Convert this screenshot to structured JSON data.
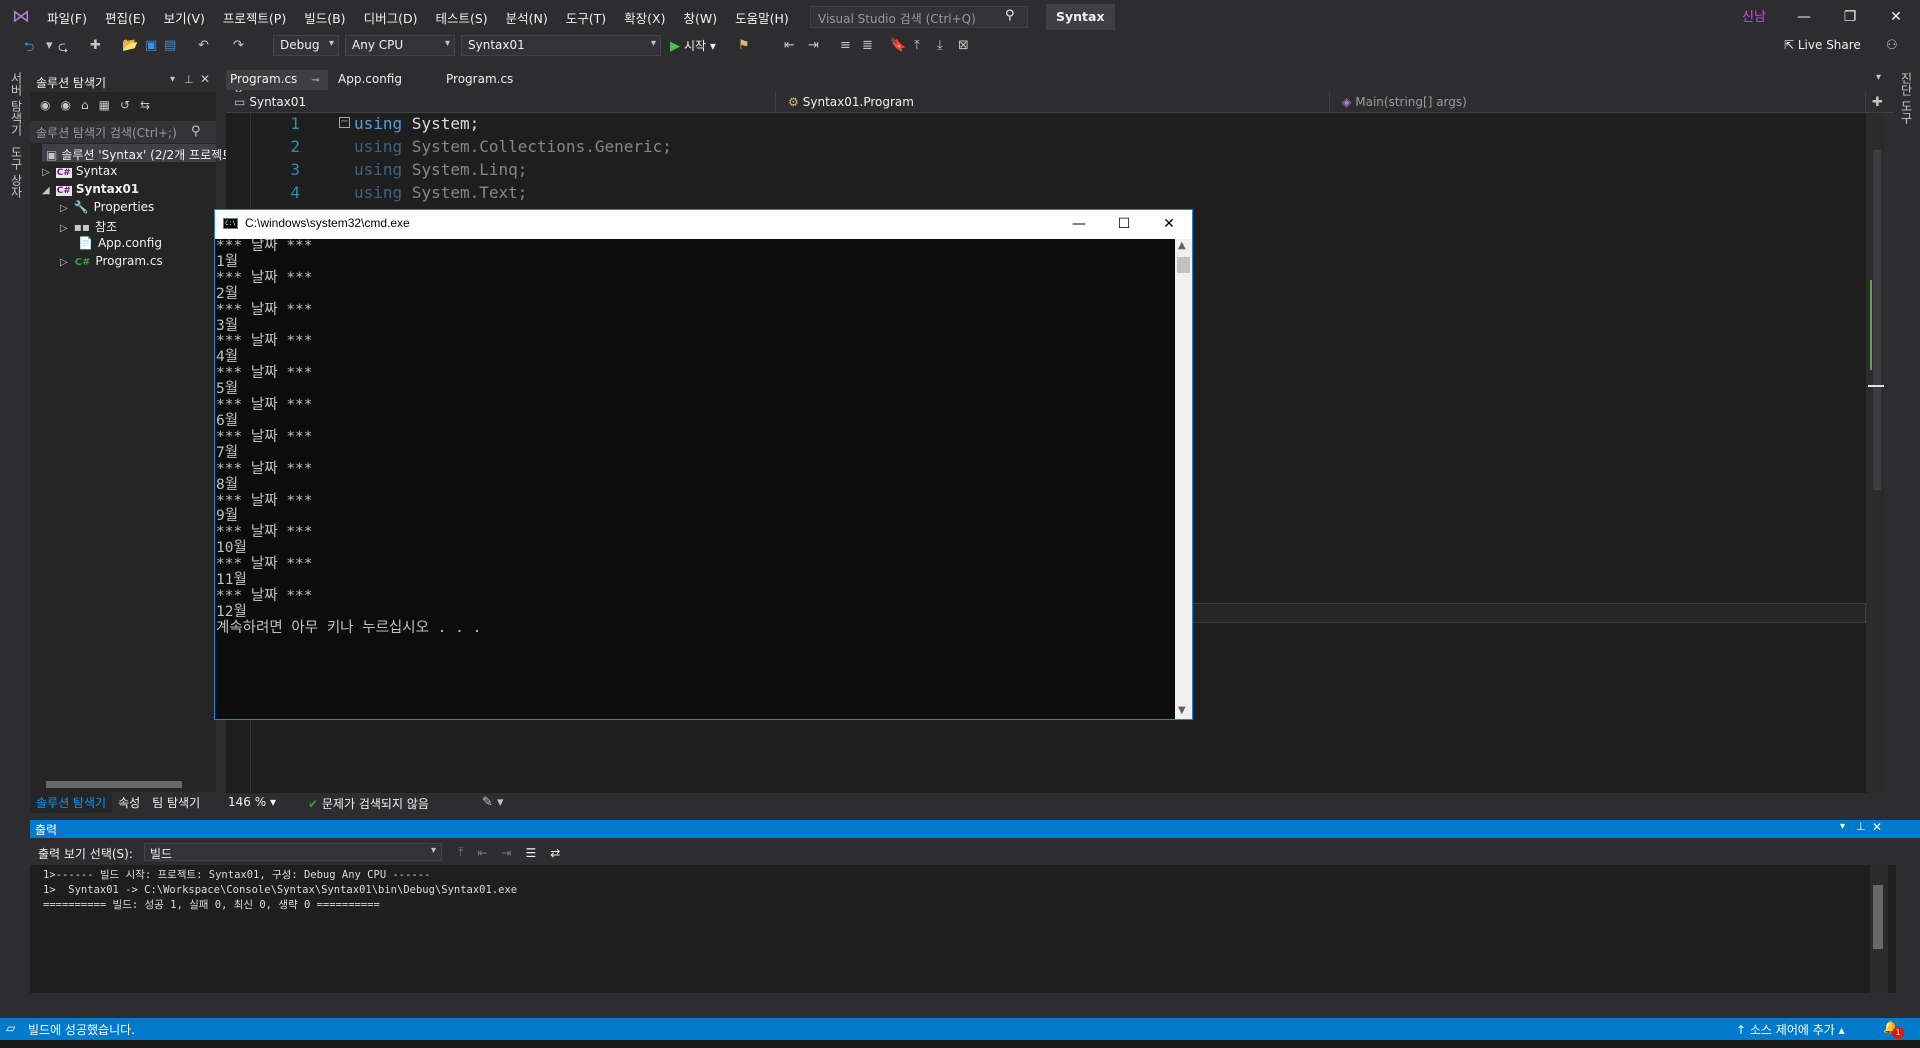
{
  "app": {
    "menu": [
      "파일(F)",
      "편집(E)",
      "보기(V)",
      "프로젝트(P)",
      "빌드(B)",
      "디버그(D)",
      "테스트(S)",
      "분석(N)",
      "도구(T)",
      "확장(X)",
      "창(W)",
      "도움말(H)"
    ],
    "search_placeholder": "Visual Studio 검색 (Ctrl+Q)",
    "solution_name": "Syntax",
    "user": "신남",
    "live_share": "Live Share"
  },
  "toolbar": {
    "config": "Debug",
    "platform": "Any CPU",
    "startup_project": "Syntax01",
    "start_label": "시작"
  },
  "left_strip": {
    "server_explorer": "서버 탐색기",
    "toolbox": "도구 상자"
  },
  "solution_explorer": {
    "title": "솔루션 탐색기",
    "search_placeholder": "솔루션 탐색기 검색(Ctrl+;)",
    "items": [
      {
        "label": "솔루션 'Syntax' (2/2개 프로젝트)"
      },
      {
        "label": "Syntax"
      },
      {
        "label": "Syntax01"
      },
      {
        "label": "Properties"
      },
      {
        "label": "참조"
      },
      {
        "label": "App.config"
      },
      {
        "label": "Program.cs"
      }
    ],
    "bottom_tabs": [
      "솔루션 탐색기",
      "속성",
      "팀 탐색기"
    ]
  },
  "editor": {
    "tabs": [
      "Program.cs",
      "App.config",
      "Program.cs"
    ],
    "nav": {
      "project": "Syntax01",
      "type": "Syntax01.Program",
      "member": "Main(string[] args)"
    },
    "lines": [
      {
        "num": "1",
        "kw": "using",
        "rest": " System;"
      },
      {
        "num": "2",
        "kw": "using",
        "rest": " System.Collections.Generic;"
      },
      {
        "num": "3",
        "kw": "using",
        "rest": " System.Linq;"
      },
      {
        "num": "4",
        "kw": "using",
        "rest": " System.Text;"
      }
    ],
    "zoom": "146 %",
    "issues": "문제가 검색되지 않음",
    "right_strip": "진단 도구"
  },
  "console": {
    "title": "C:\\windows\\system32\\cmd.exe",
    "lines": [
      "*** 날짜 ***",
      "1월",
      "*** 날짜 ***",
      "2월",
      "*** 날짜 ***",
      "3월",
      "*** 날짜 ***",
      "4월",
      "*** 날짜 ***",
      "5월",
      "*** 날짜 ***",
      "6월",
      "*** 날짜 ***",
      "7월",
      "*** 날짜 ***",
      "8월",
      "*** 날짜 ***",
      "9월",
      "*** 날짜 ***",
      "10월",
      "*** 날짜 ***",
      "11월",
      "*** 날짜 ***",
      "12월",
      "계속하려면 아무 키나 누르십시오 . . ."
    ]
  },
  "output": {
    "title": "출력",
    "show_from_label": "출력 보기 선택(S):",
    "show_from_value": "빌드",
    "lines": [
      "1>------ 빌드 시작: 프로젝트: Syntax01, 구성: Debug Any CPU ------",
      "1>  Syntax01 -> C:\\Workspace\\Console\\Syntax\\Syntax01\\bin\\Debug\\Syntax01.exe",
      "========== 빌드: 성공 1, 실패 0, 최신 0, 생략 0 =========="
    ]
  },
  "status": {
    "message": "빌드에 성공했습니다.",
    "source_control": "소스 제어에 추가",
    "notifications": "1"
  },
  "colors": {
    "accent": "#007acc",
    "editor_bg": "#1e1e1e",
    "keyword": "#569cd6",
    "line_number": "#2b91af"
  }
}
